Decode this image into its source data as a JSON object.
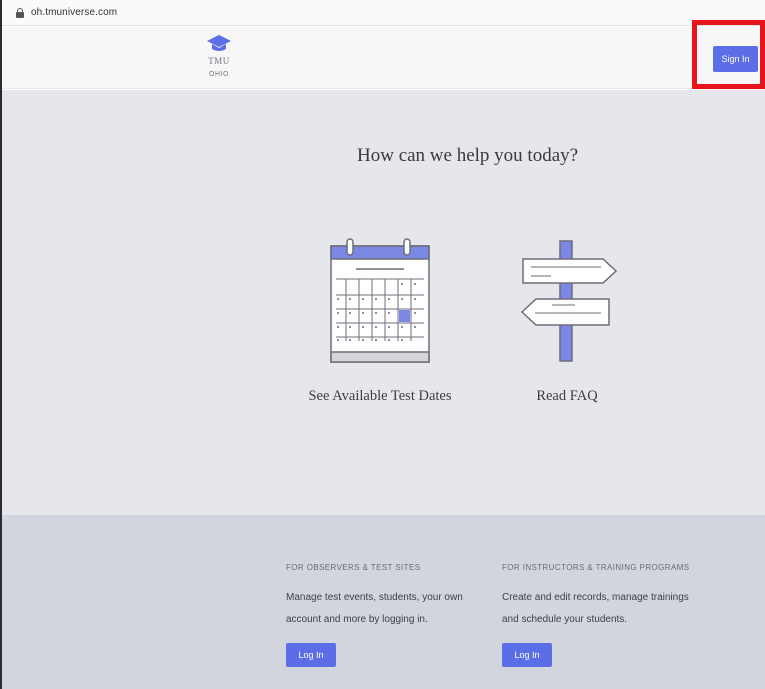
{
  "browser": {
    "url": "oh.tmuniverse.com"
  },
  "header": {
    "logo_text": "TMU",
    "logo_subtext": "OHIO",
    "sign_in_label": "Sign In"
  },
  "main": {
    "headline": "How can we help you today?",
    "cards": [
      {
        "label": "See Available Test Dates",
        "icon": "calendar-icon"
      },
      {
        "label": "Read FAQ",
        "icon": "signpost-icon"
      }
    ]
  },
  "footer": {
    "columns": [
      {
        "heading": "FOR OBSERVERS & TEST SITES",
        "description": "Manage test events, students, your own account and more by logging in.",
        "button_label": "Log In"
      },
      {
        "heading": "FOR INSTRUCTORS & TRAINING PROGRAMS",
        "description": "Create and edit records, manage trainings and schedule your students.",
        "button_label": "Log In"
      }
    ]
  },
  "colors": {
    "accent": "#5b6ee8",
    "highlight": "#e8141c",
    "main_bg": "#e6e7eb",
    "footer_bg": "#d3d5de"
  }
}
